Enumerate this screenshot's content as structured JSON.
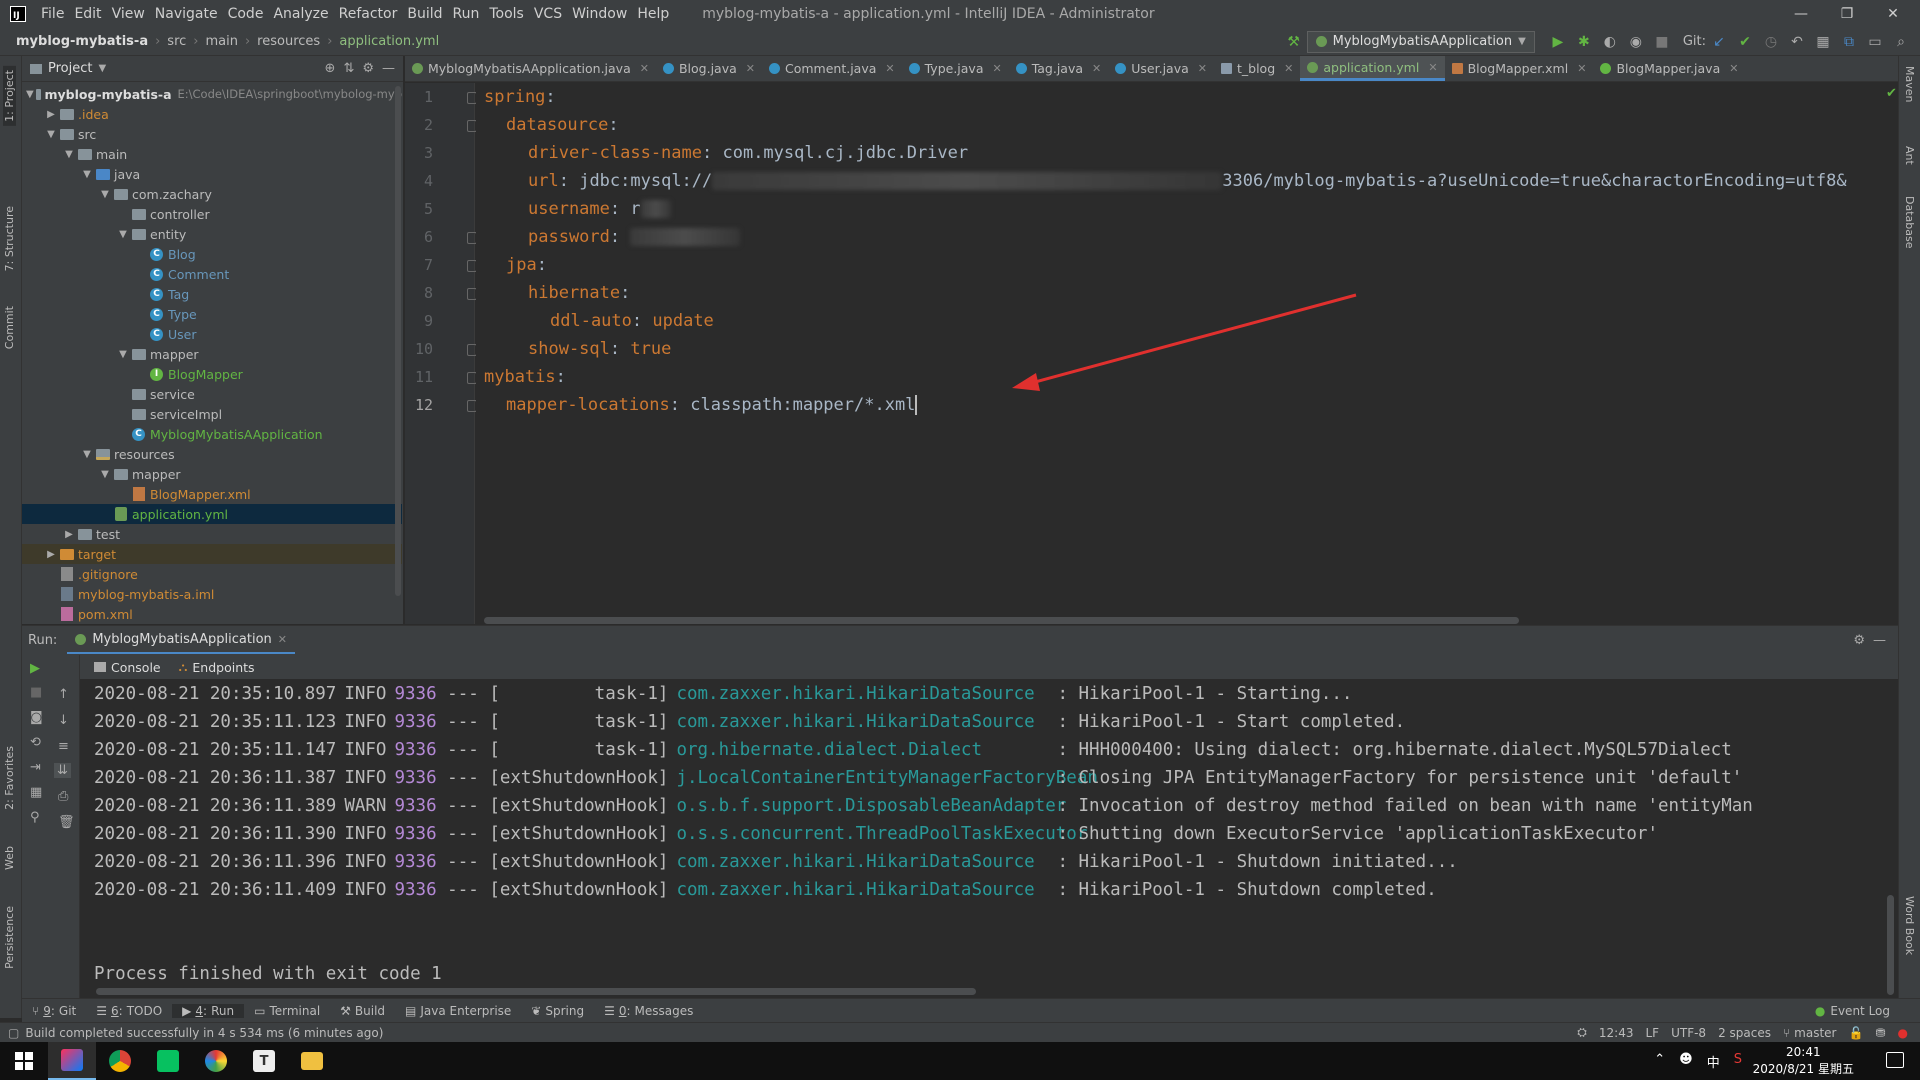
{
  "window": {
    "title": "myblog-mybatis-a - application.yml - IntelliJ IDEA - Administrator",
    "menu": [
      "File",
      "Edit",
      "View",
      "Navigate",
      "Code",
      "Analyze",
      "Refactor",
      "Build",
      "Run",
      "Tools",
      "VCS",
      "Window",
      "Help"
    ]
  },
  "navbar": {
    "crumbs": [
      "myblog-mybatis-a",
      "src",
      "main",
      "resources",
      "application.yml"
    ],
    "run_config": "MyblogMybatisAApplication",
    "git_label": "Git:"
  },
  "left_strip": [
    "1: Project",
    "7: Structure",
    "Commit",
    "2: Favorites",
    "Web",
    "Persistence"
  ],
  "right_strip": [
    "Maven",
    "Ant",
    "Database",
    "Word Book"
  ],
  "project": {
    "header": "Project",
    "tree": [
      {
        "label": "myblog-mybatis-a",
        "hint": "E:\\Code\\IDEA\\springboot\\mybolog-myb",
        "depth": 0,
        "icon": "folder",
        "arrow": "down",
        "bold": true
      },
      {
        "label": ".idea",
        "depth": 1,
        "icon": "folder",
        "arrow": "right",
        "color": "orange"
      },
      {
        "label": "src",
        "depth": 1,
        "icon": "folder",
        "arrow": "down"
      },
      {
        "label": "main",
        "depth": 2,
        "icon": "folder",
        "arrow": "down"
      },
      {
        "label": "java",
        "depth": 3,
        "icon": "folder-src",
        "arrow": "down"
      },
      {
        "label": "com.zachary",
        "depth": 4,
        "icon": "folder",
        "arrow": "down"
      },
      {
        "label": "controller",
        "depth": 5,
        "icon": "folder",
        "arrow": ""
      },
      {
        "label": "entity",
        "depth": 5,
        "icon": "folder",
        "arrow": "down"
      },
      {
        "label": "Blog",
        "depth": 6,
        "icon": "class",
        "arrow": "",
        "color": "blue"
      },
      {
        "label": "Comment",
        "depth": 6,
        "icon": "class",
        "arrow": "",
        "color": "blue"
      },
      {
        "label": "Tag",
        "depth": 6,
        "icon": "class",
        "arrow": "",
        "color": "blue"
      },
      {
        "label": "Type",
        "depth": 6,
        "icon": "class",
        "arrow": "",
        "color": "blue"
      },
      {
        "label": "User",
        "depth": 6,
        "icon": "class",
        "arrow": "",
        "color": "blue"
      },
      {
        "label": "mapper",
        "depth": 5,
        "icon": "folder",
        "arrow": "down"
      },
      {
        "label": "BlogMapper",
        "depth": 6,
        "icon": "interface",
        "arrow": "",
        "color": "green"
      },
      {
        "label": "service",
        "depth": 5,
        "icon": "folder",
        "arrow": ""
      },
      {
        "label": "serviceImpl",
        "depth": 5,
        "icon": "folder",
        "arrow": ""
      },
      {
        "label": "MyblogMybatisAApplication",
        "depth": 5,
        "icon": "class",
        "arrow": "",
        "color": "green"
      },
      {
        "label": "resources",
        "depth": 3,
        "icon": "folder-res",
        "arrow": "down"
      },
      {
        "label": "mapper",
        "depth": 4,
        "icon": "folder",
        "arrow": "down"
      },
      {
        "label": "BlogMapper.xml",
        "depth": 5,
        "icon": "xml",
        "arrow": "",
        "color": "orange"
      },
      {
        "label": "application.yml",
        "depth": 4,
        "icon": "yml",
        "arrow": "",
        "color": "green",
        "selected": true
      },
      {
        "label": "test",
        "depth": 2,
        "icon": "folder",
        "arrow": "right"
      },
      {
        "label": "target",
        "depth": 1,
        "icon": "folder-orange",
        "arrow": "right",
        "color": "orange",
        "highlight": true
      },
      {
        "label": ".gitignore",
        "depth": 1,
        "icon": "git",
        "arrow": "",
        "color": "orange"
      },
      {
        "label": "myblog-mybatis-a.iml",
        "depth": 1,
        "icon": "iml",
        "arrow": "",
        "color": "orange"
      },
      {
        "label": "pom.xml",
        "depth": 1,
        "icon": "pom",
        "arrow": "",
        "color": "orange"
      }
    ]
  },
  "editor_tabs": [
    {
      "label": "MyblogMybatisAApplication.java",
      "icon": "sp"
    },
    {
      "label": "Blog.java",
      "icon": "class"
    },
    {
      "label": "Comment.java",
      "icon": "class"
    },
    {
      "label": "Type.java",
      "icon": "class"
    },
    {
      "label": "Tag.java",
      "icon": "class"
    },
    {
      "label": "User.java",
      "icon": "class"
    },
    {
      "label": "t_blog",
      "icon": "tbl"
    },
    {
      "label": "application.yml",
      "icon": "sp",
      "active": true
    },
    {
      "label": "BlogMapper.xml",
      "icon": "xml"
    },
    {
      "label": "BlogMapper.java",
      "icon": "map"
    }
  ],
  "code": {
    "lines": [
      {
        "n": "1",
        "indent": 0,
        "key": "spring",
        "sep": ":",
        "val": ""
      },
      {
        "n": "2",
        "indent": 1,
        "key": "datasource",
        "sep": ":",
        "val": ""
      },
      {
        "n": "3",
        "indent": 2,
        "key": "driver-class-name",
        "sep": ": ",
        "val": "com.mysql.cj.jdbc.Driver"
      },
      {
        "n": "4",
        "indent": 2,
        "key": "url",
        "sep": ": ",
        "val": "jdbc:mysql://",
        "tail": "3306/myblog-mybatis-a?useUnicode=true&charactorEncoding=utf8&",
        "blur": true
      },
      {
        "n": "5",
        "indent": 2,
        "key": "username",
        "sep": ": ",
        "val": "r",
        "blur": true
      },
      {
        "n": "6",
        "indent": 2,
        "key": "password",
        "sep": ": ",
        "val": "",
        "blur": true
      },
      {
        "n": "7",
        "indent": 1,
        "key": "jpa",
        "sep": ":",
        "val": ""
      },
      {
        "n": "8",
        "indent": 2,
        "key": "hibernate",
        "sep": ":",
        "val": ""
      },
      {
        "n": "9",
        "indent": 3,
        "key": "ddl-auto",
        "sep": ": ",
        "val": "update",
        "kw": true
      },
      {
        "n": "10",
        "indent": 2,
        "key": "show-sql",
        "sep": ": ",
        "val": "true",
        "kw": true
      },
      {
        "n": "11",
        "indent": 0,
        "key": "mybatis",
        "sep": ":",
        "val": ""
      },
      {
        "n": "12",
        "indent": 1,
        "key": "mapper-locations",
        "sep": ": ",
        "val": "classpath:mapper/*.xml",
        "caret": true
      }
    ]
  },
  "run": {
    "label": "Run:",
    "tab": "MyblogMybatisAApplication",
    "subtabs": [
      "Console",
      "Endpoints"
    ],
    "log": [
      {
        "ts": "2020-08-21 20:35:10.897",
        "lvl": "INFO",
        "pid": "9336",
        "thread": "[         task-1]",
        "logger": "com.zaxxer.hikari.HikariDataSource",
        "msg": ": HikariPool-1 - Starting..."
      },
      {
        "ts": "2020-08-21 20:35:11.123",
        "lvl": "INFO",
        "pid": "9336",
        "thread": "[         task-1]",
        "logger": "com.zaxxer.hikari.HikariDataSource",
        "msg": ": HikariPool-1 - Start completed."
      },
      {
        "ts": "2020-08-21 20:35:11.147",
        "lvl": "INFO",
        "pid": "9336",
        "thread": "[         task-1]",
        "logger": "org.hibernate.dialect.Dialect",
        "msg": ": HHH000400: Using dialect: org.hibernate.dialect.MySQL57Dialect"
      },
      {
        "ts": "2020-08-21 20:36:11.387",
        "lvl": "INFO",
        "pid": "9336",
        "thread": "[extShutdownHook]",
        "logger": "j.LocalContainerEntityManagerFactoryBean",
        "msg": ": Closing JPA EntityManagerFactory for persistence unit 'default'"
      },
      {
        "ts": "2020-08-21 20:36:11.389",
        "lvl": "WARN",
        "pid": "9336",
        "thread": "[extShutdownHook]",
        "logger": "o.s.b.f.support.DisposableBeanAdapter",
        "msg": ": Invocation of destroy method failed on bean with name 'entityMan"
      },
      {
        "ts": "2020-08-21 20:36:11.390",
        "lvl": "INFO",
        "pid": "9336",
        "thread": "[extShutdownHook]",
        "logger": "o.s.s.concurrent.ThreadPoolTaskExecutor",
        "msg": ": Shutting down ExecutorService 'applicationTaskExecutor'"
      },
      {
        "ts": "2020-08-21 20:36:11.396",
        "lvl": "INFO",
        "pid": "9336",
        "thread": "[extShutdownHook]",
        "logger": "com.zaxxer.hikari.HikariDataSource",
        "msg": ": HikariPool-1 - Shutdown initiated..."
      },
      {
        "ts": "2020-08-21 20:36:11.409",
        "lvl": "INFO",
        "pid": "9336",
        "thread": "[extShutdownHook]",
        "logger": "com.zaxxer.hikari.HikariDataSource",
        "msg": ": HikariPool-1 - Shutdown completed."
      }
    ],
    "exit": "Process finished with exit code 1"
  },
  "tool_tabs": [
    {
      "num": "9",
      "label": "Git"
    },
    {
      "num": "6",
      "label": "TODO"
    },
    {
      "num": "4",
      "label": "Run"
    },
    {
      "num": "",
      "label": "Terminal"
    },
    {
      "num": "",
      "label": "Build"
    },
    {
      "num": "",
      "label": "Java Enterprise"
    },
    {
      "num": "",
      "label": "Spring"
    },
    {
      "num": "0",
      "label": "Messages"
    }
  ],
  "event_log": "Event Log",
  "status": {
    "message": "Build completed successfully in 4 s 534 ms (6 minutes ago)",
    "position": "12:43",
    "line_sep": "LF",
    "encoding": "UTF-8",
    "indent": "2 spaces",
    "branch": "master"
  },
  "taskbar": {
    "time": "20:41",
    "date": "2020/8/21 星期五",
    "ime": "中"
  },
  "colors": {
    "accent": "#4a88c7",
    "arrow": "#e0302e",
    "editor_bg": "#2b2b2b",
    "panel_bg": "#3c3f41"
  }
}
